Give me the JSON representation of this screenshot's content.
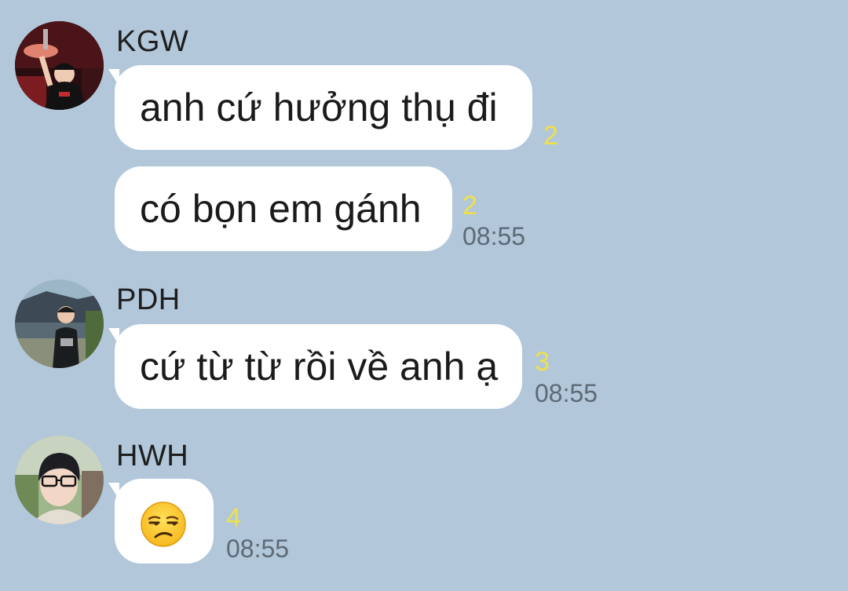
{
  "messages": [
    {
      "sender": "KGW",
      "avatar_icon": "avatar-kgw",
      "bubbles": [
        {
          "text": "anh cứ hưởng thụ đi",
          "unread": "2",
          "time": ""
        },
        {
          "text": "có bọn em gánh",
          "unread": "2",
          "time": "08:55"
        }
      ]
    },
    {
      "sender": "PDH",
      "avatar_icon": "avatar-pdh",
      "bubbles": [
        {
          "text": "cứ từ từ rồi về anh ạ",
          "unread": "3",
          "time": "08:55"
        }
      ]
    },
    {
      "sender": "HWH",
      "avatar_icon": "avatar-hwh",
      "bubbles": [
        {
          "text": "",
          "emoji": "unamused-face-emoji",
          "unread": "4",
          "time": "08:55"
        }
      ]
    }
  ],
  "colors": {
    "background": "#b2c7da",
    "bubble": "#ffffff",
    "unread": "#efe049",
    "time": "#5d6a75"
  }
}
